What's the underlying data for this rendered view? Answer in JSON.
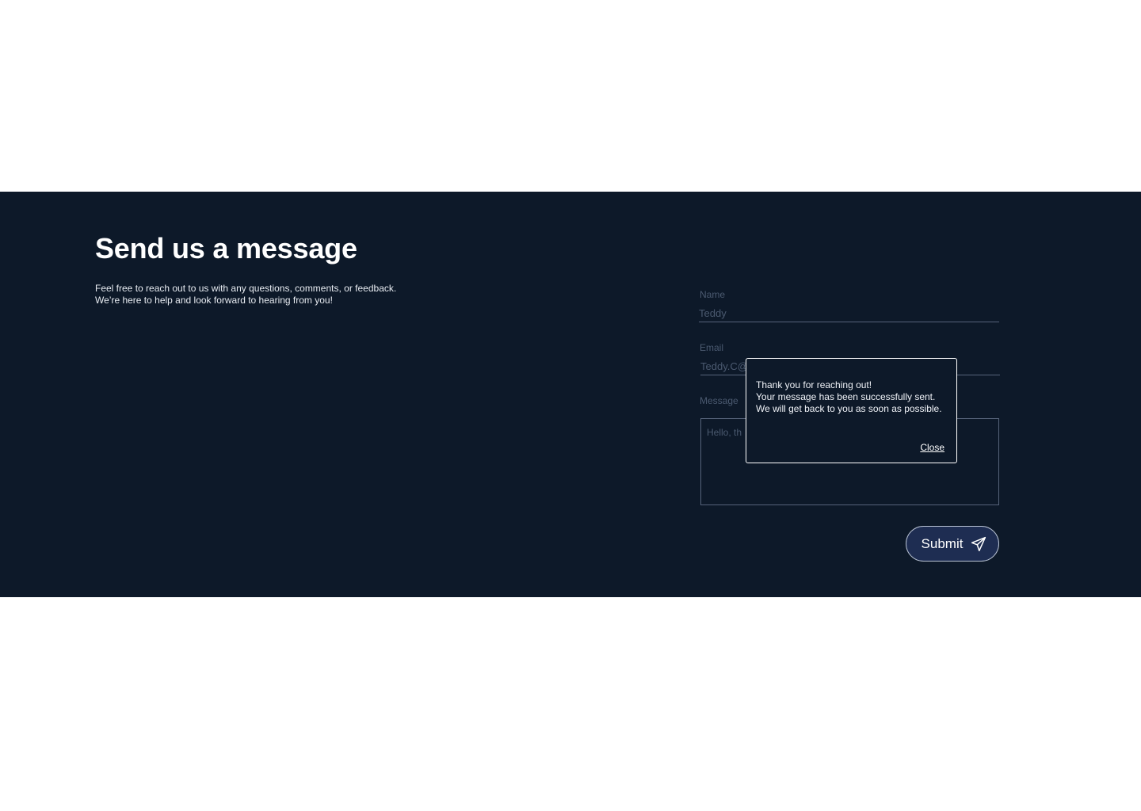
{
  "contact": {
    "title": "Send us a message",
    "intro_line1": "Feel free to reach out to us with any questions, comments, or feedback.",
    "intro_line2": "We’re here to help and look forward to hearing from you!"
  },
  "form": {
    "name_label": "Name",
    "name_value": "Teddy",
    "email_label": "Email",
    "email_value": "Teddy.C@",
    "message_label": "Message",
    "message_value": "Hello, th",
    "submit_label": "Submit",
    "submit_icon": "send-icon"
  },
  "toast": {
    "line1": "Thank you for reaching out!",
    "line2": "Your message has been successfully sent.",
    "line3": "We will get back to you as soon as possible.",
    "close_label": "Close"
  },
  "colors": {
    "section_background": "#0d1929",
    "button_background": "#1e2d52",
    "muted_text": "#4b5a70"
  }
}
